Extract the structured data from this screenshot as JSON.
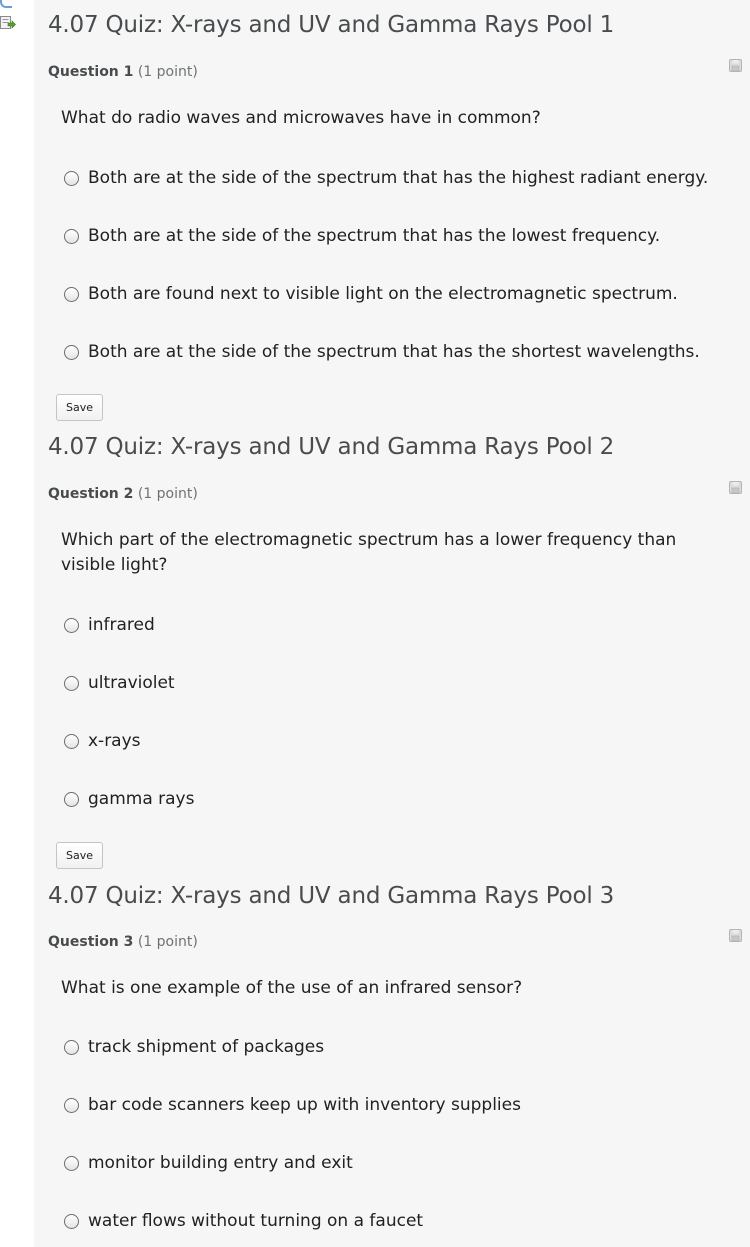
{
  "icons": {
    "jump": "jump-to-question-icon",
    "save_state": "unsaved-disk-icon",
    "radio": "radio-button-icon"
  },
  "colors": {
    "panel_bg": "#f6f6f6",
    "title_text": "#494c4e",
    "body_text": "#202122",
    "header_text": "#6e7376"
  },
  "sections": [
    {
      "title": "4.07 Quiz: X-rays and UV and Gamma Rays Pool 1",
      "question_label": "Question 1",
      "points": "(1 point)",
      "prompt": "What do radio waves and microwaves have in common?",
      "options": [
        "Both are at the side of the spectrum that has the highest radiant energy.",
        "Both are at the side of the spectrum that has the lowest frequency.",
        "Both are found next to visible light on the electromagnetic spectrum.",
        "Both are at the side of the spectrum that has the shortest wavelengths."
      ],
      "save_label": "Save"
    },
    {
      "title": "4.07 Quiz: X-rays and UV and Gamma Rays Pool 2",
      "question_label": "Question 2",
      "points": "(1 point)",
      "prompt": "Which part of the electromagnetic spectrum has a lower frequency than visible light?",
      "options": [
        "infrared",
        "ultraviolet",
        "x-rays",
        "gamma rays"
      ],
      "save_label": "Save"
    },
    {
      "title": "4.07 Quiz: X-rays and UV and Gamma Rays Pool 3",
      "question_label": "Question 3",
      "points": "(1 point)",
      "prompt": "What is one example of the use of an infrared sensor?",
      "options": [
        "track shipment of packages",
        "bar code scanners keep up with inventory supplies",
        "monitor building entry and exit",
        "water flows without turning on a faucet"
      ]
    }
  ]
}
